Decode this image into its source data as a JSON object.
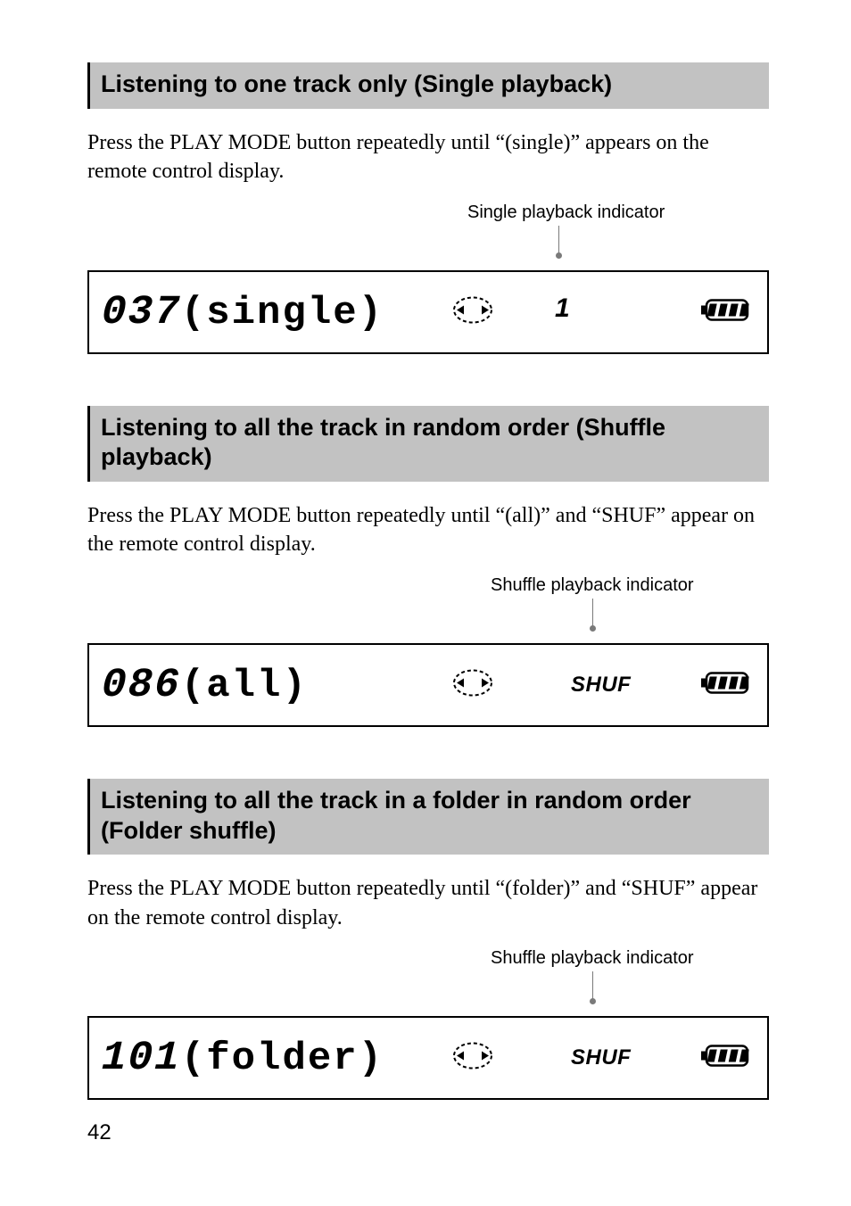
{
  "page_number": "42",
  "sections": [
    {
      "heading": "Listening to one track only (Single playback)",
      "body": "Press the PLAY MODE button repeatedly until “(single)” appears on the remote control display.",
      "callout": "Single playback indicator",
      "lcd": {
        "num": "037",
        "word": "(single)",
        "shuf": "",
        "one": "1"
      }
    },
    {
      "heading": "Listening to all the track in random order (Shuffle playback)",
      "body": "Press the PLAY MODE button repeatedly until “(all)” and “SHUF” appear on the remote control display.",
      "callout": "Shuffle playback indicator",
      "lcd": {
        "num": "086",
        "word": "(all)",
        "shuf": "SHUF",
        "one": ""
      }
    },
    {
      "heading": "Listening to all the track in a folder in random order (Folder shuffle)",
      "body": "Press the PLAY MODE button repeatedly until “(folder)” and “SHUF” appear on the remote control display.",
      "callout": "Shuffle playback indicator",
      "lcd": {
        "num": "101",
        "word": "(folder)",
        "shuf": "SHUF",
        "one": ""
      }
    }
  ]
}
